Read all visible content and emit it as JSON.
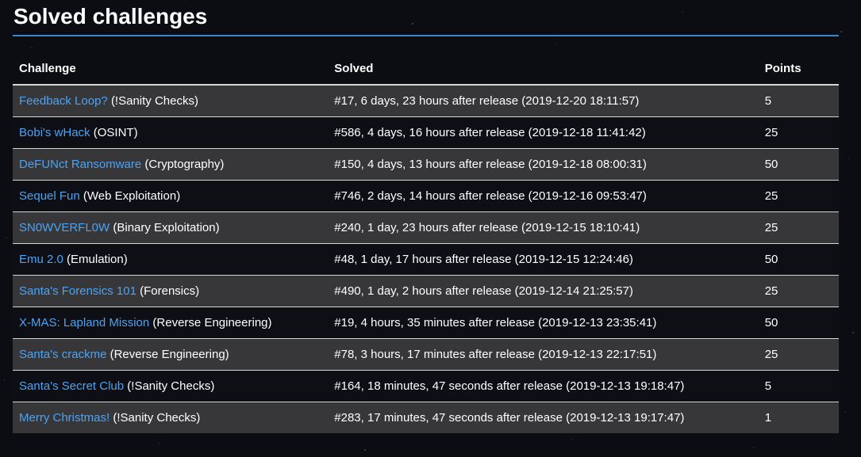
{
  "page": {
    "title": "Solved challenges"
  },
  "colors": {
    "accent_rule": "#3d86c9",
    "link": "#4aa3f5",
    "row_odd": "#444444",
    "row_even": "#121216"
  },
  "table": {
    "headers": {
      "challenge": "Challenge",
      "solved": "Solved",
      "points": "Points"
    },
    "rows": [
      {
        "name": "Feedback Loop?",
        "category": "(!Sanity Checks)",
        "solved": "#17, 6 days, 23 hours after release (2019-12-20 18:11:57)",
        "points": "5"
      },
      {
        "name": "Bobi's wHack",
        "category": "(OSINT)",
        "solved": "#586, 4 days, 16 hours after release (2019-12-18 11:41:42)",
        "points": "25"
      },
      {
        "name": "DeFUNct Ransomware",
        "category": "(Cryptography)",
        "solved": "#150, 4 days, 13 hours after release (2019-12-18 08:00:31)",
        "points": "50"
      },
      {
        "name": "Sequel Fun",
        "category": "(Web Exploitation)",
        "solved": "#746, 2 days, 14 hours after release (2019-12-16 09:53:47)",
        "points": "25"
      },
      {
        "name": "SN0WVERFL0W",
        "category": "(Binary Exploitation)",
        "solved": "#240, 1 day, 23 hours after release (2019-12-15 18:10:41)",
        "points": "25"
      },
      {
        "name": "Emu 2.0",
        "category": "(Emulation)",
        "solved": "#48, 1 day, 17 hours after release (2019-12-15 12:24:46)",
        "points": "50"
      },
      {
        "name": "Santa's Forensics 101",
        "category": "(Forensics)",
        "solved": "#490, 1 day, 2 hours after release (2019-12-14 21:25:57)",
        "points": "25"
      },
      {
        "name": "X-MAS: Lapland Mission",
        "category": "(Reverse Engineering)",
        "solved": "#19, 4 hours, 35 minutes after release (2019-12-13 23:35:41)",
        "points": "50"
      },
      {
        "name": "Santa's crackme",
        "category": "(Reverse Engineering)",
        "solved": "#78, 3 hours, 17 minutes after release (2019-12-13 22:17:51)",
        "points": "25"
      },
      {
        "name": "Santa's Secret Club",
        "category": "(!Sanity Checks)",
        "solved": "#164, 18 minutes, 47 seconds after release (2019-12-13 19:18:47)",
        "points": "5"
      },
      {
        "name": "Merry Christmas!",
        "category": "(!Sanity Checks)",
        "solved": "#283, 17 minutes, 47 seconds after release (2019-12-13 19:17:47)",
        "points": "1"
      }
    ]
  }
}
